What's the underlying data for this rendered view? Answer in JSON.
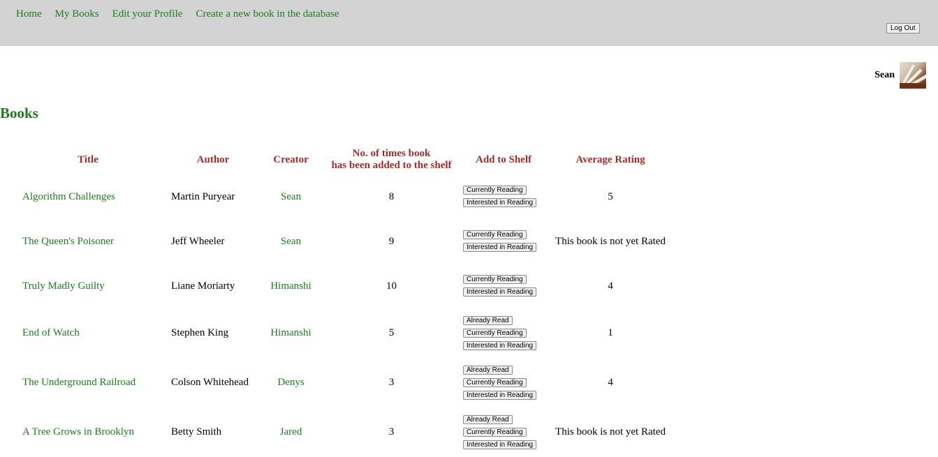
{
  "nav": {
    "items": [
      "Home",
      "My Books",
      "Edit your Profile",
      "Create a new book in the database"
    ],
    "logout_label": "Log Out"
  },
  "user": {
    "name": "Sean"
  },
  "page_title": "Books",
  "table": {
    "headers": {
      "title": "Title",
      "author": "Author",
      "creator": "Creator",
      "count_line1": "No. of times book",
      "count_line2": "has been added to the shelf",
      "shelf": "Add to Shelf",
      "rating": "Average Rating"
    },
    "rows": [
      {
        "title": "Algorithm Challenges",
        "author": "Martin Puryear",
        "creator": "Sean",
        "count": "8",
        "buttons": [
          "Currently Reading",
          "Interested in Reading"
        ],
        "rating": "5"
      },
      {
        "title": "The Queen's Poisoner",
        "author": "Jeff Wheeler",
        "creator": "Sean",
        "count": "9",
        "buttons": [
          "Currently Reading",
          "Interested in Reading"
        ],
        "rating": "This book is not yet Rated"
      },
      {
        "title": "Truly Madly Guilty",
        "author": "Liane Moriarty",
        "creator": "Himanshi",
        "count": "10",
        "buttons": [
          "Currently Reading",
          "Interested in Reading"
        ],
        "rating": "4"
      },
      {
        "title": "End of Watch",
        "author": "Stephen King",
        "creator": "Himanshi",
        "count": "5",
        "buttons": [
          "Already Read",
          "Currently Reading",
          "Interested in Reading"
        ],
        "rating": "1"
      },
      {
        "title": "The Underground Railroad",
        "author": "Colson Whitehead",
        "creator": "Denys",
        "count": "3",
        "buttons": [
          "Already Read",
          "Currently Reading",
          "Interested in Reading"
        ],
        "rating": "4"
      },
      {
        "title": "A Tree Grows in Brooklyn",
        "author": "Betty Smith",
        "creator": "Jared",
        "count": "3",
        "buttons": [
          "Already Read",
          "Currently Reading",
          "Interested in Reading"
        ],
        "rating": "This book is not yet Rated"
      }
    ]
  },
  "colors": {
    "topbar": "#d3d3d3",
    "link_green": "#1f7a1f",
    "header_red": "#a52a2a"
  }
}
